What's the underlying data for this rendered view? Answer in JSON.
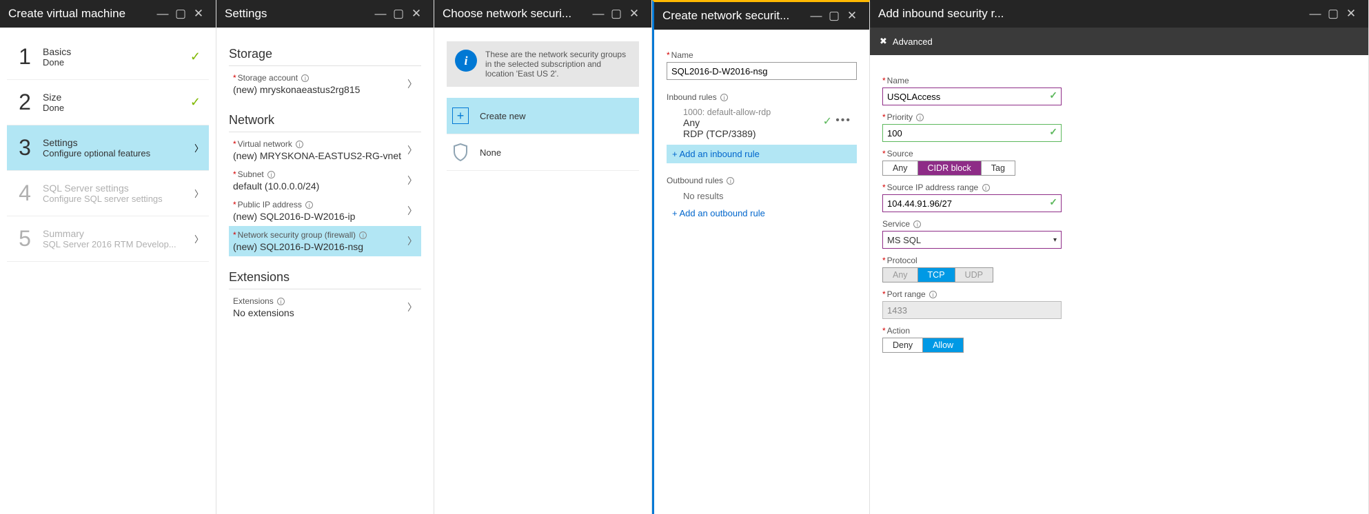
{
  "blades": {
    "createVm": {
      "title": "Create virtual machine"
    },
    "settings": {
      "title": "Settings"
    },
    "chooseNsg": {
      "title": "Choose network securi..."
    },
    "createNsg": {
      "title": "Create network securit..."
    },
    "addRule": {
      "title": "Add inbound security r..."
    }
  },
  "steps": [
    {
      "num": "1",
      "title": "Basics",
      "sub": "Done"
    },
    {
      "num": "2",
      "title": "Size",
      "sub": "Done"
    },
    {
      "num": "3",
      "title": "Settings",
      "sub": "Configure optional features"
    },
    {
      "num": "4",
      "title": "SQL Server settings",
      "sub": "Configure SQL server settings"
    },
    {
      "num": "5",
      "title": "Summary",
      "sub": "SQL Server 2016 RTM Develop..."
    }
  ],
  "settingsPanel": {
    "storage_h": "Storage",
    "storage_acct_lbl": "Storage account",
    "storage_acct_val": "(new) mryskonaeastus2rg815",
    "network_h": "Network",
    "vnet_lbl": "Virtual network",
    "vnet_val": "(new) MRYSKONA-EASTUS2-RG-vnet",
    "subnet_lbl": "Subnet",
    "subnet_val": "default (10.0.0.0/24)",
    "pip_lbl": "Public IP address",
    "pip_val": "(new) SQL2016-D-W2016-ip",
    "nsg_lbl": "Network security group (firewall)",
    "nsg_val": "(new) SQL2016-D-W2016-nsg",
    "ext_h": "Extensions",
    "ext_lbl": "Extensions",
    "ext_val": "No extensions"
  },
  "chooseNsg": {
    "info": "These are the network security groups in the selected subscription and location 'East US 2'.",
    "create_new": "Create new",
    "none": "None"
  },
  "createNsg": {
    "name_lbl": "Name",
    "name_val": "SQL2016-D-W2016-nsg",
    "inbound_h": "Inbound rules",
    "rule1_name": "1000: default-allow-rdp",
    "rule1_src": "Any",
    "rule1_dst": "RDP (TCP/3389)",
    "add_inbound": "+ Add an inbound rule",
    "outbound_h": "Outbound rules",
    "no_results": "No results",
    "add_outbound": "+ Add an outbound rule"
  },
  "addRule": {
    "advanced": "Advanced",
    "name_lbl": "Name",
    "name_val": "USQLAccess",
    "priority_lbl": "Priority",
    "priority_val": "100",
    "source_lbl": "Source",
    "src_any": "Any",
    "src_cidr": "CIDR block",
    "src_tag": "Tag",
    "src_range_lbl": "Source IP address range",
    "src_range_val": "104.44.91.96/27",
    "service_lbl": "Service",
    "service_val": "MS SQL",
    "protocol_lbl": "Protocol",
    "p_any": "Any",
    "p_tcp": "TCP",
    "p_udp": "UDP",
    "port_lbl": "Port range",
    "port_val": "1433",
    "action_lbl": "Action",
    "a_deny": "Deny",
    "a_allow": "Allow"
  }
}
